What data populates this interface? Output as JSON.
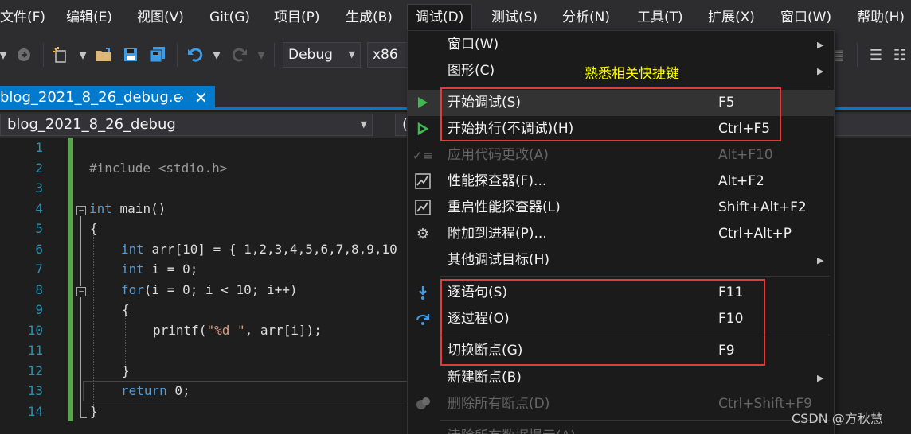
{
  "menubar": {
    "items": [
      "文件(F)",
      "编辑(E)",
      "视图(V)",
      "Git(G)",
      "项目(P)",
      "生成(B)",
      "调试(D)",
      "测试(S)",
      "分析(N)",
      "工具(T)",
      "扩展(X)",
      "窗口(W)",
      "帮助(H)"
    ],
    "active": "调试(D)"
  },
  "toolbar": {
    "config": "Debug",
    "platform": "x86"
  },
  "document_tab": {
    "title": "blog_2021_8_26_debug.c",
    "pin_icon": "⊸",
    "close_icon": "✕"
  },
  "navbar": {
    "project": "blog_2021_8_26_debug",
    "scope": "("
  },
  "editor": {
    "line_numbers": [
      "1",
      "2",
      "3",
      "4",
      "5",
      "6",
      "7",
      "8",
      "9",
      "10",
      "11",
      "12",
      "13",
      "14"
    ],
    "lines": {
      "l2": "#include <stdio.h>",
      "l4_kw": "int",
      "l4_rest": " main()",
      "l5": "{",
      "l6_kw": "int",
      "l6_rest": " arr[10] = { 1,2,3,4,5,6,7,8,9,10",
      "l7_kw": "int",
      "l7_rest": " i = 0;",
      "l8_kw": "for",
      "l8_rest": "(i = 0; i < 10; i++)",
      "l9": "{",
      "l10_fn": "printf(",
      "l10_str": "\"%d \"",
      "l10_rest": ", arr[i]);",
      "l12": "}",
      "l13_kw": "return",
      "l13_rest": " 0;",
      "l14": "}"
    }
  },
  "debug_menu": {
    "annotation": "熟悉相关快捷键",
    "items": [
      {
        "label": "窗口(W)",
        "shortcut": "",
        "submenu": true,
        "icon": "",
        "disabled": false
      },
      {
        "label": "图形(C)",
        "shortcut": "",
        "submenu": true,
        "icon": "",
        "disabled": false
      },
      {
        "label": "开始调试(S)",
        "shortcut": "F5",
        "submenu": false,
        "icon": "start-debugging-icon",
        "disabled": false
      },
      {
        "label": "开始执行(不调试)(H)",
        "shortcut": "Ctrl+F5",
        "submenu": false,
        "icon": "start-without-debugging-icon",
        "disabled": false
      },
      {
        "label": "应用代码更改(A)",
        "shortcut": "Alt+F10",
        "submenu": false,
        "icon": "apply-code-changes-icon",
        "disabled": true
      },
      {
        "label": "性能探查器(F)...",
        "shortcut": "Alt+F2",
        "submenu": false,
        "icon": "performance-profiler-icon",
        "disabled": false
      },
      {
        "label": "重启性能探查器(L)",
        "shortcut": "Shift+Alt+F2",
        "submenu": false,
        "icon": "relaunch-profiler-icon",
        "disabled": false
      },
      {
        "label": "附加到进程(P)...",
        "shortcut": "Ctrl+Alt+P",
        "submenu": false,
        "icon": "attach-process-icon",
        "disabled": false
      },
      {
        "label": "其他调试目标(H)",
        "shortcut": "",
        "submenu": true,
        "icon": "",
        "disabled": false
      },
      {
        "label": "逐语句(S)",
        "shortcut": "F11",
        "submenu": false,
        "icon": "step-into-icon",
        "disabled": false
      },
      {
        "label": "逐过程(O)",
        "shortcut": "F10",
        "submenu": false,
        "icon": "step-over-icon",
        "disabled": false
      },
      {
        "label": "切换断点(G)",
        "shortcut": "F9",
        "submenu": false,
        "icon": "",
        "disabled": false
      },
      {
        "label": "新建断点(B)",
        "shortcut": "",
        "submenu": true,
        "icon": "",
        "disabled": false
      },
      {
        "label": "删除所有断点(D)",
        "shortcut": "Ctrl+Shift+F9",
        "submenu": false,
        "icon": "delete-breakpoints-icon",
        "disabled": true
      },
      {
        "label": "清除所有数据提示(A)",
        "shortcut": "",
        "submenu": false,
        "icon": "",
        "disabled": true
      }
    ]
  },
  "watermark": "CSDN @方秋慧",
  "colors": {
    "accent": "#007acc",
    "annotation": "#ffff00",
    "highlight_box": "#e03c3c",
    "play_green": "#3fb950"
  }
}
